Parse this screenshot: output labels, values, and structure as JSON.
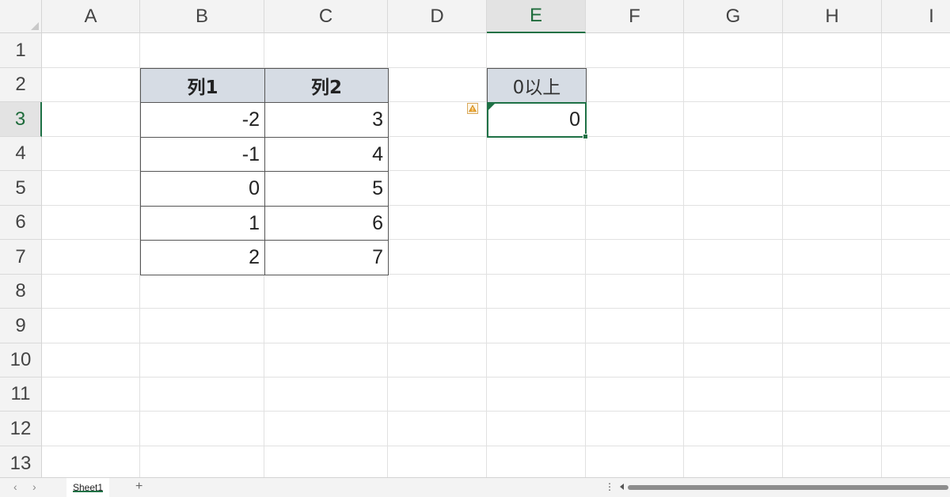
{
  "columns": [
    "A",
    "B",
    "C",
    "D",
    "E",
    "F",
    "G",
    "H",
    "I"
  ],
  "active_column": "E",
  "rows": [
    "1",
    "2",
    "3",
    "4",
    "5",
    "6",
    "7",
    "8",
    "9",
    "10",
    "11",
    "12",
    "13"
  ],
  "active_row": "3",
  "table": {
    "headers": [
      "列1",
      "列2"
    ],
    "rows": [
      [
        "-2",
        "3"
      ],
      [
        "-1",
        "4"
      ],
      [
        "0",
        "5"
      ],
      [
        "1",
        "6"
      ],
      [
        "2",
        "7"
      ]
    ]
  },
  "result": {
    "header": "0以上",
    "value": "0",
    "selected_cell": "E3"
  },
  "warning_icon": "warning-triangle-icon",
  "sheet_tabs": [
    {
      "label": "Sheet1",
      "active": true
    }
  ],
  "add_sheet_label": "+",
  "nav": {
    "prev": "‹",
    "next": "›"
  },
  "more_options_label": "⋮",
  "colors": {
    "accent": "#1e7145",
    "table_header_fill": "#d6dce4",
    "header_bg": "#f3f3f3"
  }
}
